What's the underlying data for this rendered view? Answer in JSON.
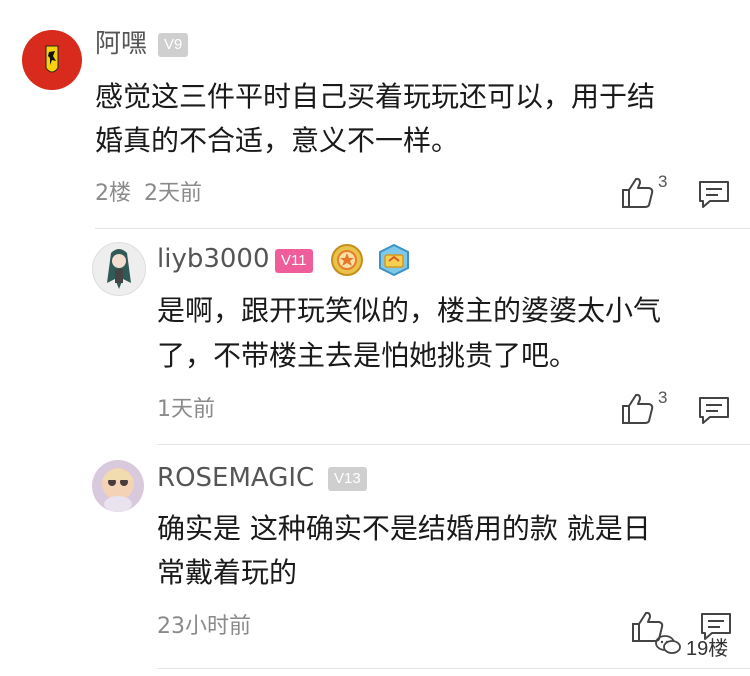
{
  "comments": [
    {
      "author": "阿嘿",
      "level": "V9",
      "text_lines": [
        "感觉这三件平时自己买着玩玩还可以，用于结",
        "婚真的不合适，意义不一样。"
      ],
      "floor": "2楼",
      "time": "2天前",
      "likes": "3"
    }
  ],
  "replies": [
    {
      "author": "liyb3000",
      "level": "V11",
      "text_lines": [
        "是啊，跟开玩笑似的，楼主的婆婆太小气",
        "了，不带楼主去是怕她挑贵了吧。"
      ],
      "time": "1天前",
      "likes": "3"
    },
    {
      "author": "ROSEMAGIC",
      "level": "V13",
      "text_lines": [
        "确实是 这种确实不是结婚用的款 就是日",
        "常戴着玩的"
      ],
      "time": "23小时前"
    }
  ],
  "watermark": "19楼",
  "colors": {
    "avatar_red": "#d82a1d",
    "level_gray": "#cfcfcf",
    "level_pink": "#ef5d9a"
  },
  "icons": {
    "like": "thumbs-up-icon",
    "reply": "comment-bubble-icon",
    "brand": "ferrari-horse-icon"
  }
}
